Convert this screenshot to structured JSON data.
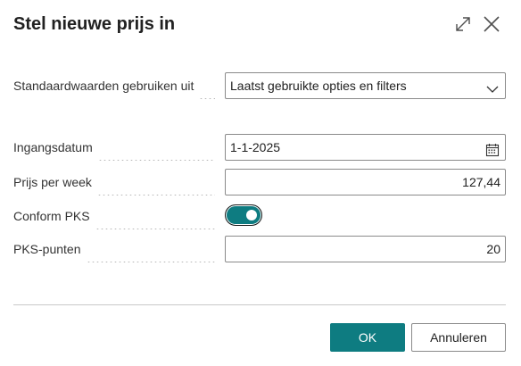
{
  "dialog": {
    "title": "Stel nieuwe prijs in",
    "expand_icon": "expand-icon",
    "close_icon": "close-icon"
  },
  "fields": {
    "defaults": {
      "label": "Standaardwaarden gebruiken uit",
      "value": "Laatst gebruikte opties en filters",
      "icon": "chevron-down-icon"
    },
    "start_date": {
      "label": "Ingangsdatum",
      "value": "1-1-2025",
      "icon": "calendar-icon"
    },
    "weekly_price": {
      "label": "Prijs per week",
      "value": "127,44"
    },
    "pks": {
      "label": "Conform PKS",
      "checked": true
    },
    "pks_points": {
      "label": "PKS-punten",
      "value": "20"
    }
  },
  "buttons": {
    "ok": "OK",
    "cancel": "Annuleren"
  },
  "colors": {
    "accent": "#0e7c81"
  }
}
